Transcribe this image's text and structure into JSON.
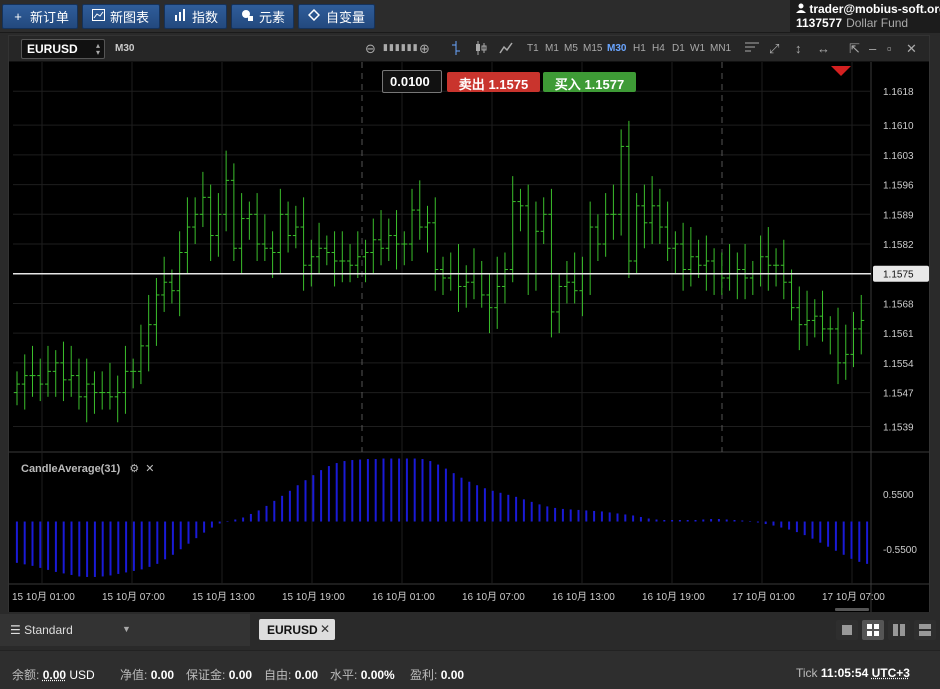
{
  "toolbar": {
    "new_order": "新订单",
    "new_chart": "新图表",
    "indicators": "指数",
    "elements": "元素",
    "custom_vars": "自变量"
  },
  "account": {
    "user": "trader@mobius-soft.org",
    "number": "1137577",
    "fund": "Dollar Fund"
  },
  "chart_header": {
    "symbol": "EURUSD",
    "timeframe": "M30",
    "timeframes": [
      "T1",
      "M1",
      "M5",
      "M15",
      "M30",
      "H1",
      "H4",
      "D1",
      "W1",
      "MN1"
    ],
    "active_timeframe": "M30"
  },
  "trade": {
    "lot": "0.0100",
    "sell_label": "卖出",
    "sell_price": "1.1575",
    "buy_label": "买入",
    "buy_price": "1.1577"
  },
  "indicator": {
    "name": "CandleAverage(31)"
  },
  "colors": {
    "bar": "#3bbf2c",
    "indicator": "#1a1ad6",
    "sell": "#c9342d",
    "buy": "#3e9b36",
    "toolbar_btn": "#2f5d9a"
  },
  "chart_data": {
    "type": "ohlc",
    "price_axis": [
      "1.1618",
      "1.1610",
      "1.1603",
      "1.1596",
      "1.1589",
      "1.1582",
      "1.1568",
      "1.1561",
      "1.1554",
      "1.1547",
      "1.1539"
    ],
    "current_price": "1.1575",
    "ylim": [
      1.1533,
      1.1623
    ],
    "indicator_axis": [
      "0.5500",
      "-0.5500"
    ],
    "indicator_ylim": [
      -1.2,
      1.3
    ],
    "time_axis": [
      "15 10月 01:00",
      "15 10月 07:00",
      "15 10月 13:00",
      "15 10月 19:00",
      "16 10月 01:00",
      "16 10月 07:00",
      "16 10月 13:00",
      "16 10月 19:00",
      "17 10月 01:00",
      "17 10月 07:00"
    ],
    "close": [
      1.1549,
      1.1551,
      1.1551,
      1.1549,
      1.1552,
      1.1554,
      1.155,
      1.1551,
      1.1546,
      1.1549,
      1.1547,
      1.1547,
      1.1546,
      1.1547,
      1.1552,
      1.1552,
      1.1558,
      1.1563,
      1.157,
      1.1573,
      1.1571,
      1.158,
      1.1586,
      1.1589,
      1.1593,
      1.1584,
      1.1589,
      1.1597,
      1.1581,
      1.1588,
      1.1589,
      1.1582,
      1.1581,
      1.158,
      1.1589,
      1.1584,
      1.1586,
      1.1577,
      1.1579,
      1.1581,
      1.158,
      1.1578,
      1.1578,
      1.1577,
      1.1579,
      1.158,
      1.1583,
      1.1581,
      1.1584,
      1.1582,
      1.1582,
      1.159,
      1.1586,
      1.1587,
      1.1576,
      1.1574,
      1.1575,
      1.1572,
      1.1573,
      1.1575,
      1.157,
      1.1567,
      1.1572,
      1.1576,
      1.1592,
      1.1591,
      1.1575,
      1.1585,
      1.1589,
      1.1566,
      1.1572,
      1.1573,
      1.1571,
      1.1575,
      1.1586,
      1.1582,
      1.1589,
      1.1589,
      1.1605,
      1.1578,
      1.1591,
      1.1587,
      1.1591,
      1.1586,
      1.1581,
      1.1582,
      1.1576,
      1.1579,
      1.1577,
      1.1578,
      1.1575,
      1.1574,
      1.1575,
      1.1576,
      1.1574,
      1.1575,
      1.1579,
      1.1577,
      1.1577,
      1.1573,
      1.1567,
      1.1563,
      1.1564,
      1.1565,
      1.1562,
      1.1562,
      1.1554,
      1.1556,
      1.1562,
      1.1564
    ],
    "indicator_values": [
      -0.82,
      -0.85,
      -0.88,
      -0.92,
      -0.96,
      -1.0,
      -1.03,
      -1.06,
      -1.09,
      -1.1,
      -1.1,
      -1.09,
      -1.07,
      -1.04,
      -1.01,
      -0.98,
      -0.95,
      -0.9,
      -0.84,
      -0.75,
      -0.66,
      -0.55,
      -0.44,
      -0.33,
      -0.22,
      -0.12,
      -0.04,
      0.01,
      0.04,
      0.08,
      0.15,
      0.22,
      0.31,
      0.41,
      0.51,
      0.61,
      0.72,
      0.82,
      0.92,
      1.02,
      1.1,
      1.16,
      1.2,
      1.22,
      1.23,
      1.24,
      1.24,
      1.25,
      1.25,
      1.25,
      1.25,
      1.25,
      1.24,
      1.2,
      1.13,
      1.05,
      0.96,
      0.87,
      0.79,
      0.72,
      0.66,
      0.61,
      0.57,
      0.53,
      0.49,
      0.44,
      0.39,
      0.34,
      0.3,
      0.27,
      0.25,
      0.24,
      0.23,
      0.22,
      0.21,
      0.2,
      0.18,
      0.16,
      0.14,
      0.12,
      0.09,
      0.06,
      0.04,
      0.03,
      0.03,
      0.03,
      0.03,
      0.03,
      0.04,
      0.05,
      0.05,
      0.04,
      0.03,
      0.02,
      0.01,
      -0.02,
      -0.05,
      -0.08,
      -0.12,
      -0.16,
      -0.21,
      -0.27,
      -0.34,
      -0.42,
      -0.5,
      -0.58,
      -0.66,
      -0.74,
      -0.8,
      -0.84
    ]
  },
  "tabs": {
    "layout_name": "Standard",
    "open_tab": "EURUSD"
  },
  "status": {
    "balance_label": "余额:",
    "balance_value": "0.00",
    "balance_currency": "USD",
    "equity_label": "净值:",
    "equity_value": "0.00",
    "margin_label": "保证金:",
    "margin_value": "0.00",
    "free_label": "自由:",
    "free_value": "0.00",
    "level_label": "水平:",
    "level_value": "0.00%",
    "profit_label": "盈利:",
    "profit_value": "0.00",
    "tick_label": "Tick",
    "time": "11:05:54",
    "timezone": "UTC+3"
  }
}
